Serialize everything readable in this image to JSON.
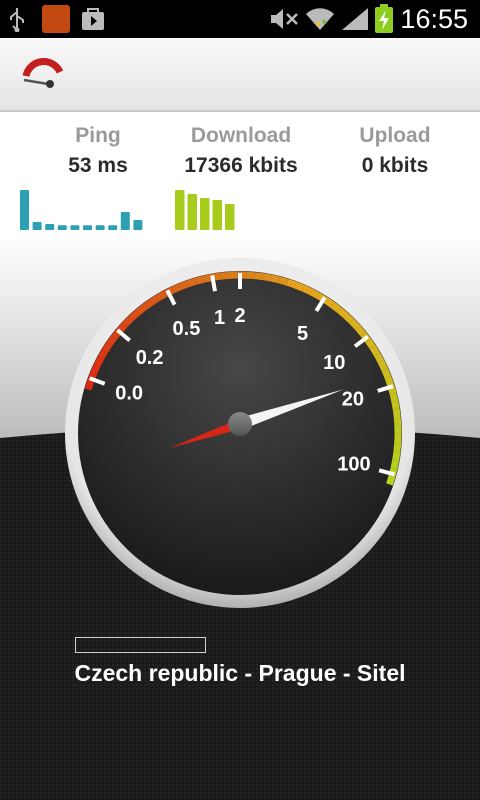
{
  "statusbar": {
    "time": "16:55"
  },
  "stats": {
    "ping": {
      "label": "Ping",
      "value": "53 ms",
      "bars": [
        1.0,
        0.2,
        0.15,
        0.12,
        0.12,
        0.12,
        0.12,
        0.12,
        0.45,
        0.25
      ]
    },
    "download": {
      "label": "Download",
      "value": "17366 kbits",
      "bars": [
        1.0,
        0.9,
        0.8,
        0.75,
        0.65
      ]
    },
    "upload": {
      "label": "Upload",
      "value": "0 kbits"
    }
  },
  "gauge": {
    "labels": [
      "0.0",
      "0.2",
      "0.5",
      "1",
      "2",
      "5",
      "10",
      "20",
      "100"
    ],
    "needle_value": "17366 kbits"
  },
  "server": "Czech republic - Prague - Sitel",
  "colors": {
    "ping_bar": "#2ea0b4",
    "download_bar": "#a8cc1c",
    "status_bg": "#000000"
  }
}
